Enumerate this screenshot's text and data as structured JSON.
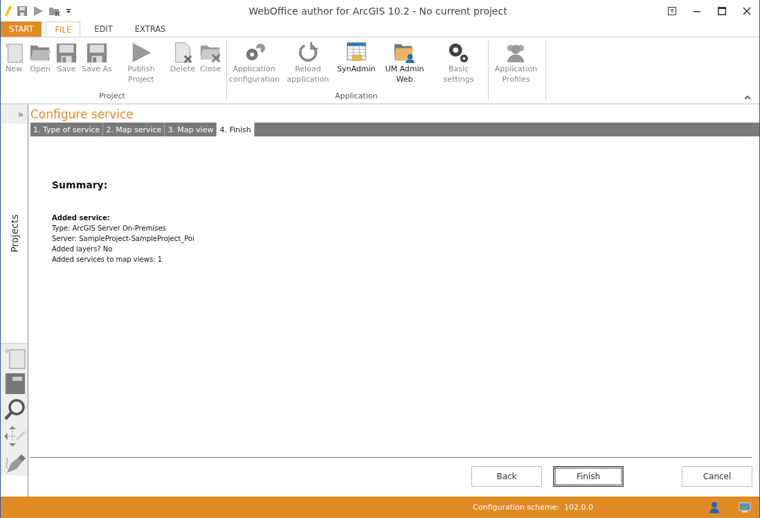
{
  "window": {
    "title": "WebOffice author for ArcGIS 10.2 - No current project"
  },
  "start_button": {
    "label": "START"
  },
  "ribbon_tabs": [
    {
      "label": "FILE",
      "kind": "tab",
      "selected": true
    },
    {
      "label": "EDIT",
      "kind": "tab",
      "selected": false
    },
    {
      "label": "EXTRAS",
      "kind": "tab",
      "selected": false
    }
  ],
  "ribbon_groups": [
    {
      "label": "Project",
      "buttons": [
        {
          "label": "New",
          "kind": "new",
          "disabled": true
        },
        {
          "label": "Open",
          "kind": "open",
          "disabled": true
        },
        {
          "label": "Save",
          "kind": "save",
          "disabled": true
        },
        {
          "label": "Save As",
          "kind": "save",
          "disabled": true
        },
        {
          "label": "Publish Project",
          "kind": "publish",
          "disabled": true
        },
        {
          "label": "Delete",
          "kind": "delete",
          "disabled": true
        },
        {
          "label": "Close",
          "kind": "close",
          "disabled": true
        }
      ]
    },
    {
      "label": "Application",
      "buttons": [
        {
          "label": "Application configuration",
          "kind": "config",
          "disabled": true
        },
        {
          "label": "Reload application",
          "kind": "reload",
          "disabled": true
        },
        {
          "label": "SynAdmin",
          "kind": "table",
          "disabled": false
        },
        {
          "label": "UM Admin Web",
          "kind": "userfolder",
          "disabled": false
        },
        {
          "label": "Basic settings",
          "kind": "gears",
          "disabled": true
        }
      ]
    },
    {
      "buttons": [
        {
          "label": "Application Profiles",
          "kind": "users",
          "disabled": true
        }
      ]
    }
  ],
  "sidebar": {
    "expand": "»",
    "label": "Projects",
    "tools": [
      {
        "kind": "new"
      },
      {
        "kind": "notebook"
      },
      {
        "kind": "search"
      },
      {
        "kind": "move"
      },
      {
        "kind": "pen"
      }
    ]
  },
  "page": {
    "title": "Configure service",
    "steps": [
      {
        "label": "1. Type of service",
        "selected": false
      },
      {
        "label": "2. Map service",
        "selected": false
      },
      {
        "label": "3. Map view",
        "selected": false
      },
      {
        "label": "4. Finish",
        "selected": true
      }
    ],
    "heading": "Summary:",
    "lines": [
      {
        "text": "Added service:",
        "kind": "heading"
      },
      {
        "text": "Type: ArcGIS Server On-Premises",
        "kind": "line"
      },
      {
        "text": "Server: SampleProject-SampleProject_Poi",
        "kind": "line"
      },
      {
        "text": "Added layers? No",
        "kind": "line"
      },
      {
        "text": "Added services to map views: 1",
        "kind": "line"
      }
    ],
    "buttons": [
      {
        "label": "Back",
        "kind": "back",
        "focused": false
      },
      {
        "label": "Finish",
        "kind": "finish",
        "focused": true
      },
      {
        "label": "Cancel",
        "kind": "cancel",
        "focused": false
      }
    ]
  },
  "status_bar": {
    "text": "Configuration scheme:  102.0.0"
  }
}
